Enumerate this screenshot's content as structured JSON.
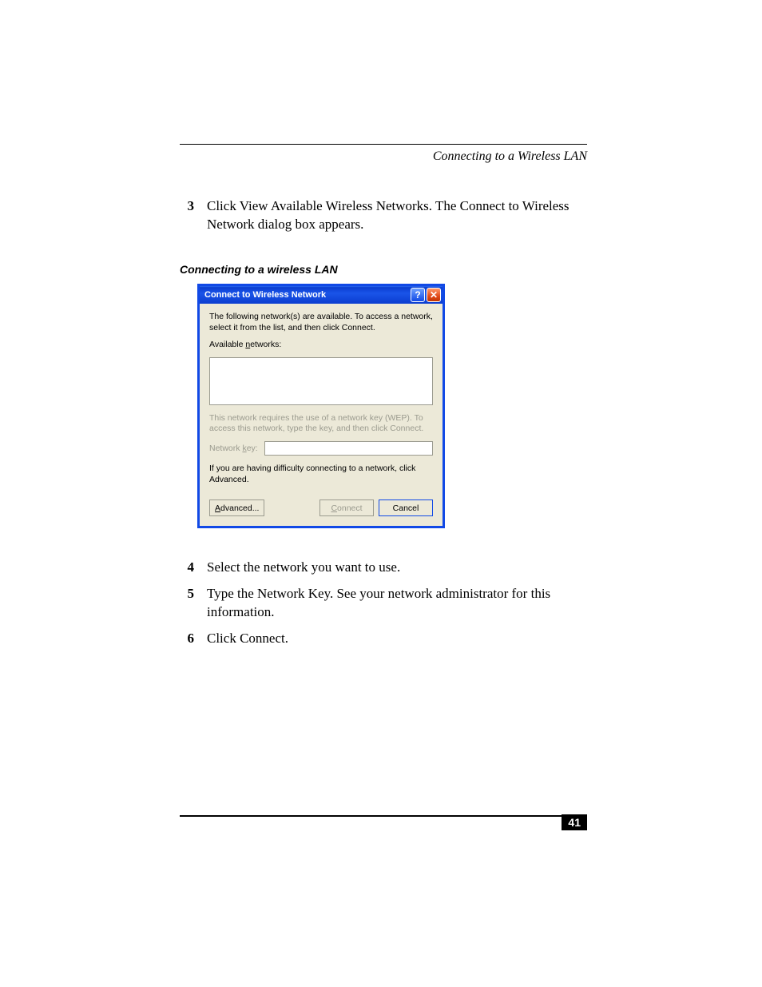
{
  "header": {
    "running_title": "Connecting to a Wireless LAN"
  },
  "steps_before": [
    {
      "num": "3",
      "text": "Click View Available Wireless Networks. The Connect to Wireless Network dialog box appears."
    }
  ],
  "caption": "Connecting to a wireless LAN",
  "dialog": {
    "title": "Connect to Wireless Network",
    "help_glyph": "?",
    "close_glyph": "✕",
    "intro": "The following network(s) are available. To access a network, select it from the list, and then click Connect.",
    "available_prefix": "Available ",
    "available_u": "n",
    "available_suffix": "etworks:",
    "wep_text": "This network requires the use of a network key (WEP). To access this network, type the key, and then click Connect.",
    "key_prefix": "Network ",
    "key_u": "k",
    "key_suffix": "ey:",
    "key_value": "",
    "advanced_text": "If you are having difficulty connecting to a network, click Advanced.",
    "btn_advanced_u": "A",
    "btn_advanced_rest": "dvanced...",
    "btn_connect_u": "C",
    "btn_connect_rest": "onnect",
    "btn_cancel": "Cancel"
  },
  "steps_after": [
    {
      "num": "4",
      "text": "Select the network you want to use."
    },
    {
      "num": "5",
      "text": "Type the Network Key. See your network administrator for this information."
    },
    {
      "num": "6",
      "text": "Click Connect."
    }
  ],
  "page_number": "41"
}
